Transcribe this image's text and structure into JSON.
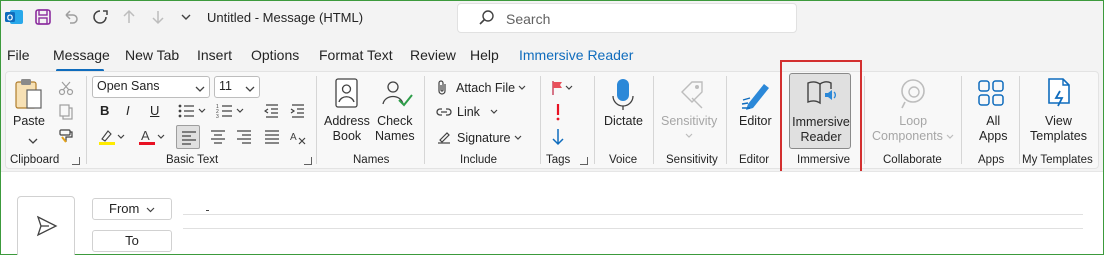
{
  "titlebar": {
    "window_title": "Untitled  -  Message (HTML)",
    "search_placeholder": "Search"
  },
  "tabs": [
    {
      "label": "File"
    },
    {
      "label": "Message"
    },
    {
      "label": "New Tab"
    },
    {
      "label": "Insert"
    },
    {
      "label": "Options"
    },
    {
      "label": "Format Text"
    },
    {
      "label": "Review"
    },
    {
      "label": "Help"
    },
    {
      "label": "Immersive Reader"
    }
  ],
  "ribbon": {
    "clipboard": {
      "paste_label": "Paste",
      "group_label": "Clipboard"
    },
    "basic_text": {
      "font_name": "Open Sans",
      "font_size": "11",
      "group_label": "Basic Text",
      "bold": "B",
      "italic": "I",
      "underline": "U"
    },
    "names": {
      "address_book_line1": "Address",
      "address_book_line2": "Book",
      "check_names_line1": "Check",
      "check_names_line2": "Names",
      "group_label": "Names"
    },
    "include": {
      "attach_file": "Attach File",
      "link": "Link",
      "signature": "Signature",
      "group_label": "Include"
    },
    "tags": {
      "group_label": "Tags"
    },
    "voice": {
      "dictate": "Dictate",
      "group_label": "Voice"
    },
    "sensitivity": {
      "button": "Sensitivity",
      "group_label": "Sensitivity"
    },
    "editor": {
      "button": "Editor",
      "group_label": "Editor"
    },
    "immersive": {
      "line1": "Immersive",
      "line2": "Reader",
      "group_label": "Immersive"
    },
    "collaborate": {
      "line1": "Loop",
      "line2": "Components",
      "group_label": "Collaborate"
    },
    "apps": {
      "line1": "All",
      "line2": "Apps",
      "group_label": "Apps"
    },
    "templates": {
      "line1": "View",
      "line2": "Templates",
      "group_label": "My Templates"
    }
  },
  "compose": {
    "from_label": "From",
    "to_label": "To"
  },
  "colors": {
    "accent": "#0f6cbd",
    "highlight_box": "#d32f2f",
    "outlook_blue": "#0f6cbd"
  }
}
